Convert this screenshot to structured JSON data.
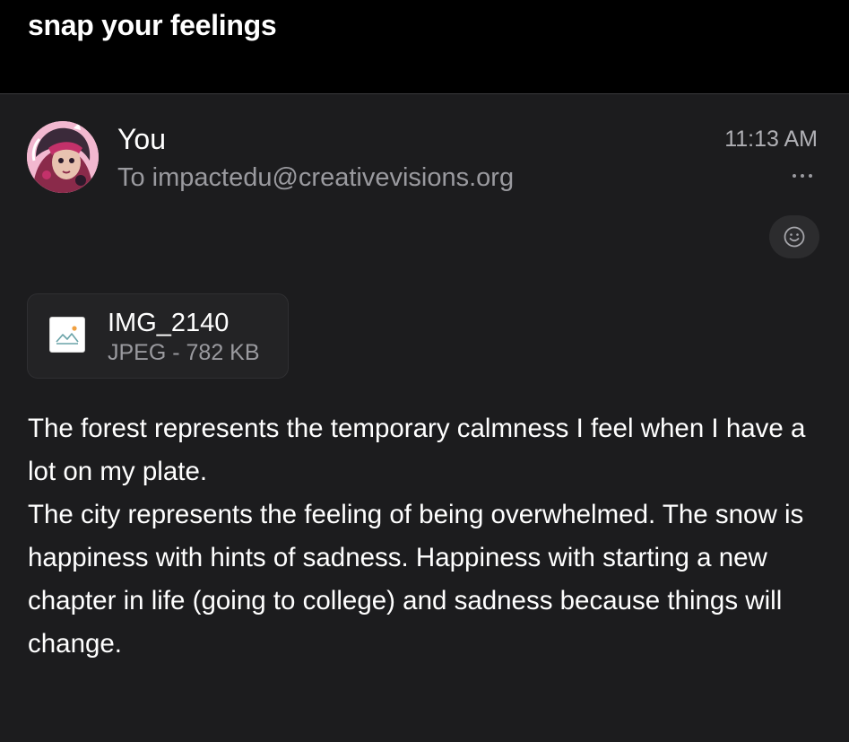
{
  "header": {
    "subject": "snap your feelings"
  },
  "message": {
    "sender": "You",
    "recipient": "To impactedu@creativevisions.org",
    "time": "11:13 AM"
  },
  "attachment": {
    "name": "IMG_2140",
    "meta": "JPEG - 782 KB",
    "icon": "image-file-icon"
  },
  "body": {
    "paragraphs": [
      "The forest represents the temporary calmness I feel when I have a lot on my plate.",
      "The city represents the feeling of being overwhelmed. The snow is happiness with hints of sadness. Happiness with starting a new chapter in life (going to college) and sadness because things will change."
    ]
  },
  "colors": {
    "background": "#1c1c1e",
    "topbar": "#000000",
    "secondary_text": "#9a9a9f",
    "chip": "#2c2c2e"
  }
}
